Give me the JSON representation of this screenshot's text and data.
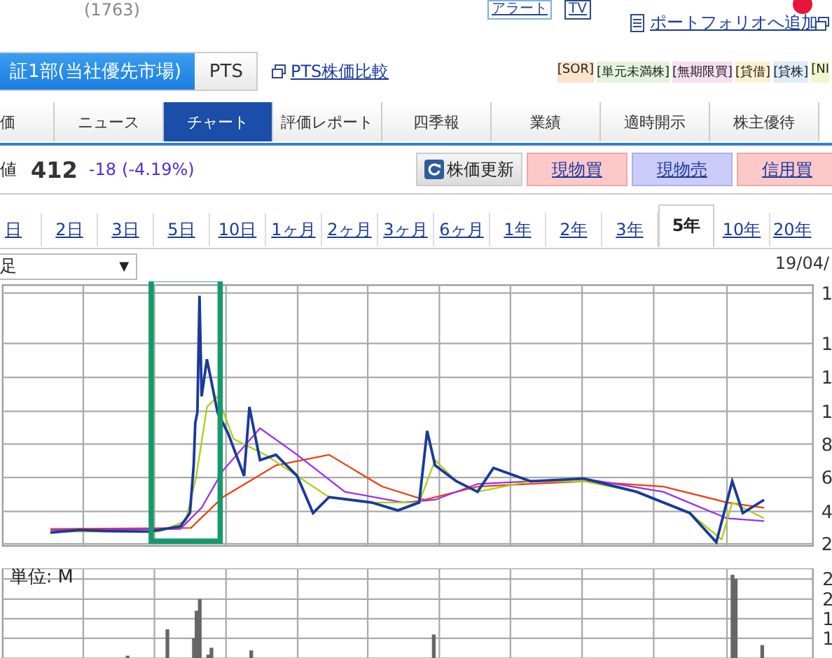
{
  "header": {
    "code": "(1763)",
    "alert_button": "アラート",
    "tv_button": "TV",
    "portfolio_link": "ポートフォリオへ追加"
  },
  "market_tabs": [
    {
      "label": "証1部(当社優先市場)",
      "selected": true
    },
    {
      "label": "PTS",
      "selected": false
    }
  ],
  "pts_link": "PTS株価比較",
  "tags": [
    {
      "label": "[SOR]",
      "color": "#fde3cc"
    },
    {
      "label": "[単元未満株]",
      "color": "#e3f3dc"
    },
    {
      "label": "[無期限買]",
      "color": "#f7def2"
    },
    {
      "label": "[貸借]",
      "color": "#fbf0cf"
    },
    {
      "label": "[貸株]",
      "color": "#dcecf8"
    },
    {
      "label": "[NI",
      "color": "#eef8c8"
    }
  ],
  "nav_tabs": [
    {
      "label": "価",
      "selected": false
    },
    {
      "label": "ニュース",
      "selected": false
    },
    {
      "label": "チャート",
      "selected": true
    },
    {
      "label": "評価レポート",
      "selected": false
    },
    {
      "label": "四季報",
      "selected": false
    },
    {
      "label": "業績",
      "selected": false
    },
    {
      "label": "適時開示",
      "selected": false
    },
    {
      "label": "株主優待",
      "selected": false
    }
  ],
  "quote": {
    "label": "値",
    "price": "412",
    "change": "-18",
    "change_pct": "(-4.19%)"
  },
  "actions": [
    {
      "label": "株価更新",
      "kind": "refresh"
    },
    {
      "label": "現物買",
      "kind": "buy"
    },
    {
      "label": "現物売",
      "kind": "sell"
    },
    {
      "label": "信用買",
      "kind": "buy"
    }
  ],
  "periods": [
    {
      "label": "日",
      "selected": false
    },
    {
      "label": "2日",
      "selected": false
    },
    {
      "label": "3日",
      "selected": false
    },
    {
      "label": "5日",
      "selected": false
    },
    {
      "label": "10日",
      "selected": false
    },
    {
      "label": "1ヶ月",
      "selected": false
    },
    {
      "label": "2ヶ月",
      "selected": false
    },
    {
      "label": "3ヶ月",
      "selected": false
    },
    {
      "label": "6ヶ月",
      "selected": false
    },
    {
      "label": "1年",
      "selected": false
    },
    {
      "label": "2年",
      "selected": false
    },
    {
      "label": "3年",
      "selected": false
    },
    {
      "label": "5年",
      "selected": true
    },
    {
      "label": "10年",
      "selected": false
    },
    {
      "label": "20年",
      "selected": false
    }
  ],
  "chart": {
    "interval": "足",
    "dropdown_arrow": "▼",
    "date": "19/04/",
    "price_axis": [
      "1",
      "1",
      "1",
      "1",
      "8",
      "6",
      "4",
      "2"
    ],
    "highlight": true,
    "volume_unit": "単位: M",
    "volume_axis": [
      "2",
      "2",
      "1",
      "1"
    ]
  }
}
